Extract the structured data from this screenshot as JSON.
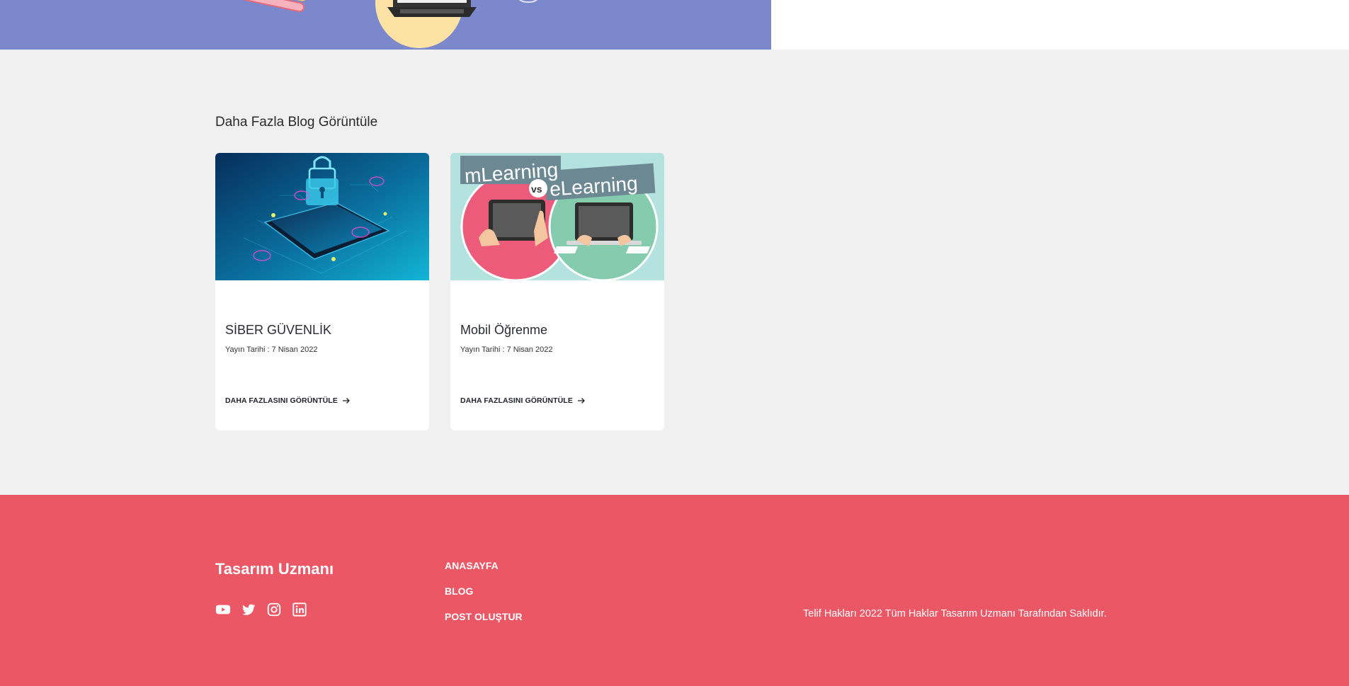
{
  "blog": {
    "heading": "Daha Fazla Blog Görüntüle",
    "cards": [
      {
        "image_icon": "cyber-security-lock-phone-image",
        "title": "SİBER GÜVENLİK",
        "date": "Yayın Tarihi : 7 Nisan 2022",
        "more_label": "DAHA FAZLASINI GÖRÜNTÜLE"
      },
      {
        "image_icon": "mlearning-vs-elearning-image",
        "image_text_left": "mLearning",
        "image_text_vs": "vs",
        "image_text_right": "eLearning",
        "title": "Mobil Öğrenme",
        "date": "Yayın Tarihi : 7 Nisan 2022",
        "more_label": "DAHA FAZLASINI GÖRÜNTÜLE"
      }
    ]
  },
  "footer": {
    "brand": "Tasarım Uzmanı",
    "socials": [
      "youtube-icon",
      "twitter-icon",
      "instagram-icon",
      "linkedin-icon"
    ],
    "nav": [
      "ANASAYFA",
      "BLOG",
      "POST OLUŞTUR"
    ],
    "copyright": "Telif Hakları 2022 Tüm Haklar Tasarım Uzmanı Tarafından Saklıdır."
  },
  "colors": {
    "hero": "#7b88cc",
    "section_bg": "#f0f0f0",
    "footer": "#ec5766"
  }
}
